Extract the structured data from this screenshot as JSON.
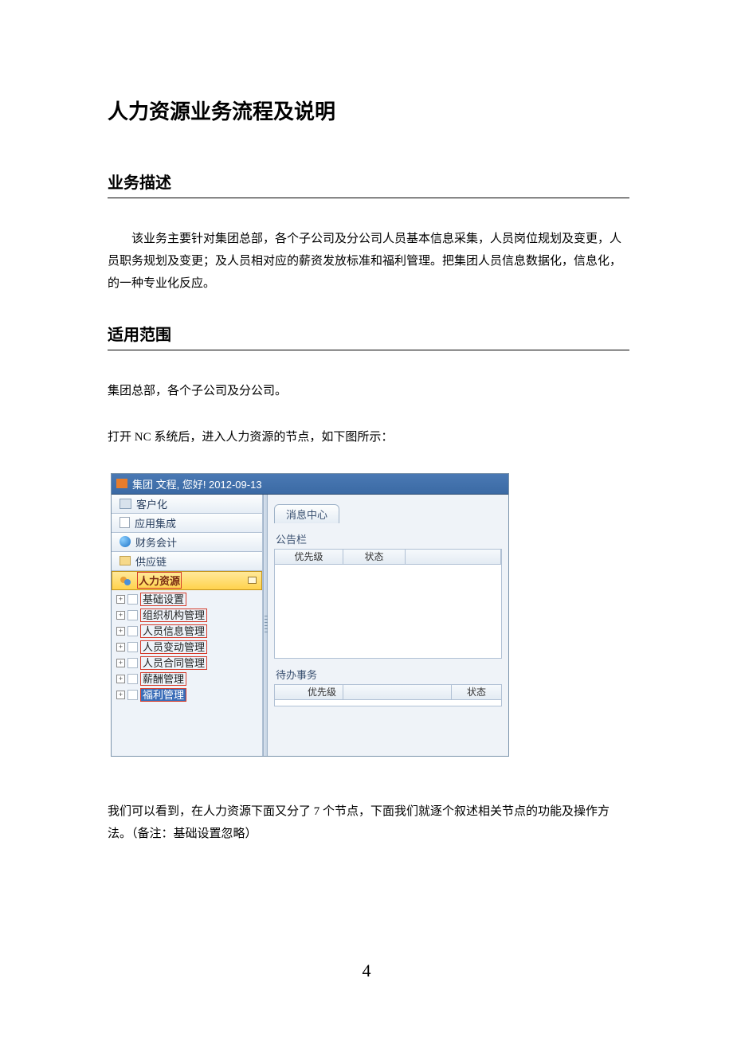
{
  "title": "人力资源业务流程及说明",
  "sections": {
    "s1_title": "业务描述",
    "s1_para": "该业务主要针对集团总部，各个子公司及分公司人员基本信息采集，人员岗位规划及变更，人员职务规划及变更；及人员相对应的薪资发放标准和福利管理。把集团人员信息数据化，信息化，的一种专业化反应。",
    "s2_title": "适用范围",
    "s2_p1": "集团总部，各个子公司及分公司。",
    "s2_p2": "打开 NC 系统后，进入人力资源的节点，如下图所示：",
    "s2_p3": "我们可以看到，在人力资源下面又分了 7 个节点，下面我们就逐个叙述相关节点的功能及操作方法。（备注：基础设置忽略）"
  },
  "screenshot": {
    "window_title": "集团 文程, 您好! 2012-09-13",
    "nav": {
      "n1": "客户化",
      "n2": "应用集成",
      "n3": "财务会计",
      "n4": "供应链",
      "n5": "人力资源"
    },
    "tree": {
      "t1": "基础设置",
      "t2": "组织机构管理",
      "t3": "人员信息管理",
      "t4": "人员变动管理",
      "t5": "人员合同管理",
      "t6": "薪酬管理",
      "t7": "福利管理"
    },
    "right": {
      "tab": "消息中心",
      "panel1_title": "公告栏",
      "panel2_title": "待办事务",
      "col_priority": "优先级",
      "col_status": "状态"
    }
  },
  "page_number": "4"
}
